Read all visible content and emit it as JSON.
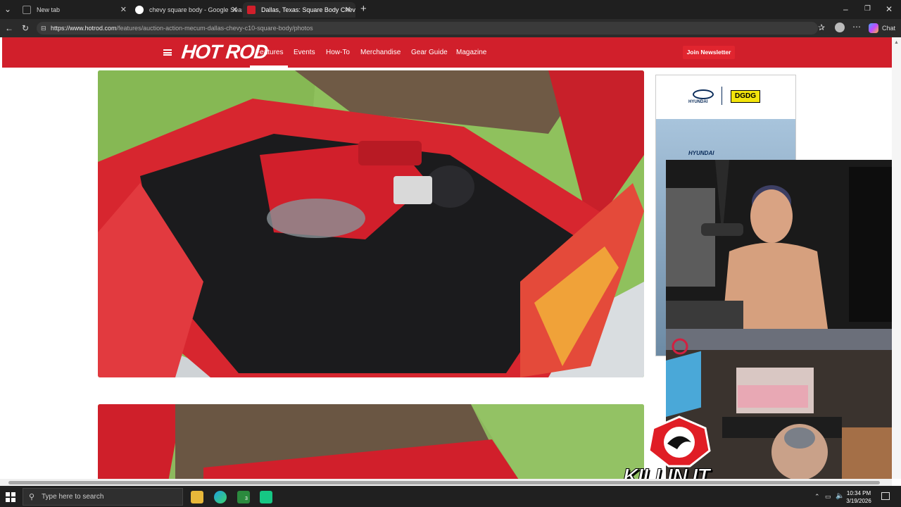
{
  "tabs": [
    {
      "title": "New tab"
    },
    {
      "title": "chevy square body - Google Search"
    },
    {
      "title": "Dallas, Texas: Square Body Chevy C"
    }
  ],
  "address": {
    "url_host": "https://www.hotrod.com",
    "url_path": "/features/auction-action-mecum-dallas-chevy-c10-square-body/photos"
  },
  "toolbar": {
    "chat_label": "Chat"
  },
  "site": {
    "logo": "HOT ROD",
    "nav": [
      "Features",
      "Events",
      "How-To",
      "Merchandise",
      "Gear Guide",
      "Magazine"
    ],
    "join_label": "Join Newsletter"
  },
  "ad": {
    "brand1": "HYUNDAI",
    "brand2": "DGDG",
    "headline": "HYUNDAI"
  },
  "overlay": {
    "brand": "KILLIN IT"
  },
  "taskbar": {
    "search_placeholder": "Type here to search",
    "time": "10:34 PM",
    "date": "3/19/2026",
    "badge": "3"
  },
  "colors": {
    "brand_red": "#d11f2b",
    "tab_bg": "#1f1f1f"
  }
}
